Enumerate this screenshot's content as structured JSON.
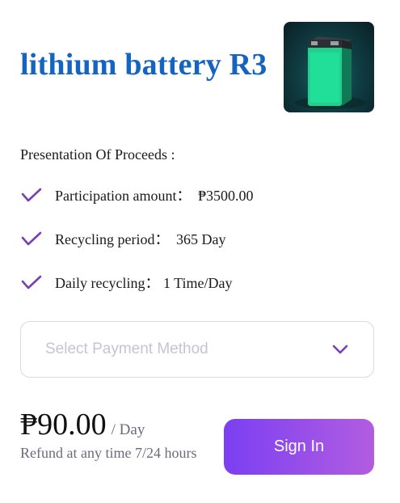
{
  "product": {
    "title": "lithium battery R3",
    "image_name": "lithium-battery-image"
  },
  "proceeds": {
    "heading": "Presentation Of Proceeds :",
    "items": [
      {
        "label": "Participation amount：",
        "value": "₱3500.00"
      },
      {
        "label": "Recycling period：",
        "value": "365 Day"
      },
      {
        "label": "Daily recycling：",
        "value": "1 Time/Day"
      }
    ]
  },
  "payment": {
    "placeholder": "Select Payment Method"
  },
  "pricing": {
    "price": "₱90.00",
    "unit": "/ Day",
    "refund_note": "Refund at any time 7/24 hours"
  },
  "actions": {
    "sign_in_label": "Sign In"
  },
  "colors": {
    "title": "#1565c0",
    "check": "#7b3fb5",
    "button_start": "#7b3ff2",
    "button_end": "#b25de0"
  }
}
